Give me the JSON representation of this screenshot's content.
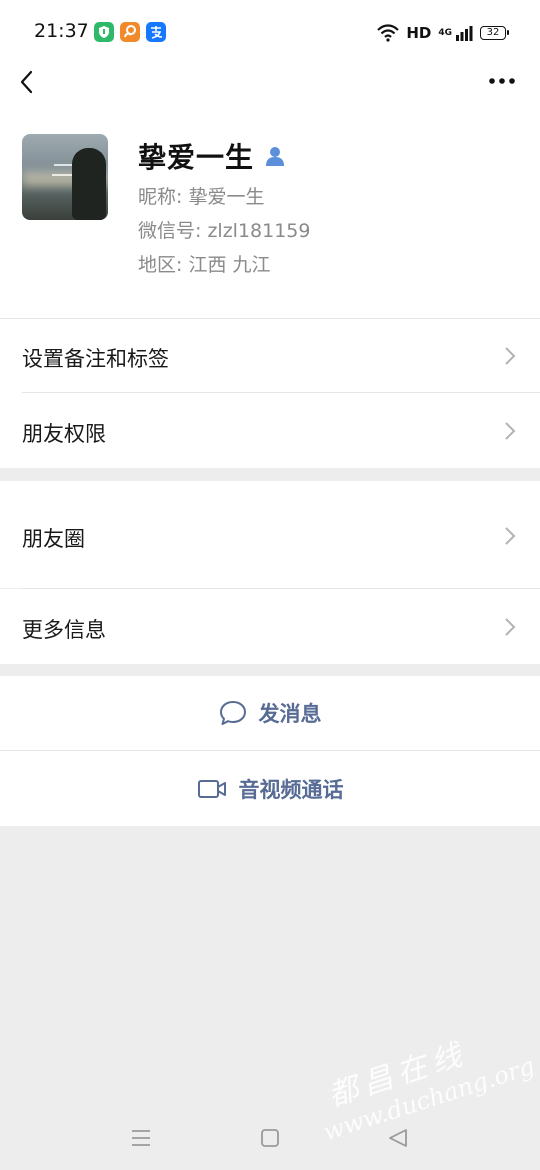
{
  "status_bar": {
    "time": "21:37",
    "signal_label": "HD",
    "network_label": "4G",
    "battery": "32",
    "app_icons": [
      "shield-app-icon",
      "squirrel-app-icon",
      "alipay-app-icon"
    ]
  },
  "nav": {
    "back_icon": "chevron-left-icon",
    "more_icon": "more-dots-icon"
  },
  "profile": {
    "display_name": "挚爱一生",
    "nickname_line": "昵称: 挚爱一生",
    "wechat_id_line": "微信号: zlzl181159",
    "region_line": "地区: 江西  九江",
    "gender_icon": "male-user-icon",
    "accent_color": "#5b8fd9"
  },
  "menu_section_1": [
    {
      "label": "设置备注和标签"
    },
    {
      "label": "朋友权限"
    }
  ],
  "menu_section_2": [
    {
      "label": "朋友圈"
    },
    {
      "label": "更多信息"
    }
  ],
  "actions": {
    "message_label": "发消息",
    "message_icon": "chat-bubble-icon",
    "call_label": "音视频通话",
    "call_icon": "video-camera-icon",
    "color": "#576b95"
  },
  "system_nav": {
    "icons": [
      "menu-icon",
      "home-square-icon",
      "back-triangle-icon"
    ]
  },
  "watermark": {
    "chinese": "都昌在线",
    "url": "www.duchang.org"
  }
}
